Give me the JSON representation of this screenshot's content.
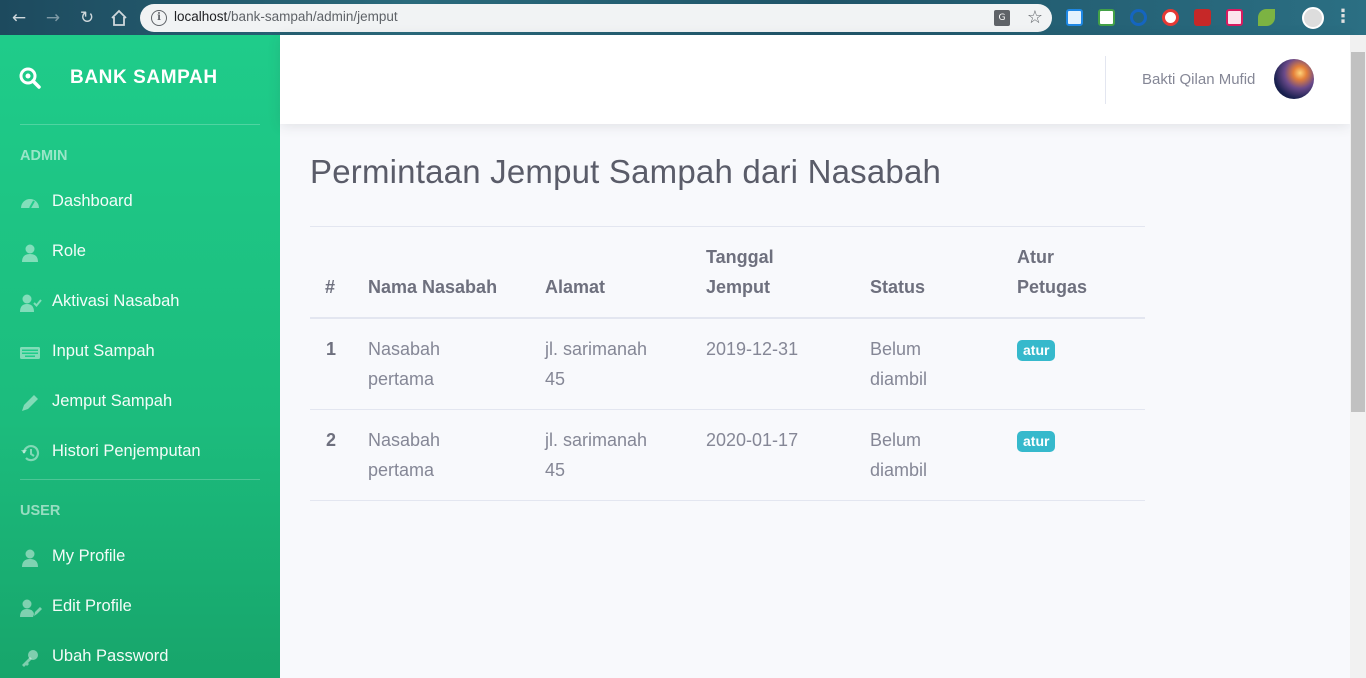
{
  "browser": {
    "url_host": "localhost",
    "url_path": "/bank-sampah/admin/jemput"
  },
  "sidebar": {
    "brand": "BANK SAMPAH",
    "admin_heading": "ADMIN",
    "admin_items": [
      {
        "label": "Dashboard",
        "icon": "tachometer-icon"
      },
      {
        "label": "Role",
        "icon": "user-tie-icon"
      },
      {
        "label": "Aktivasi Nasabah",
        "icon": "user-check-icon"
      },
      {
        "label": "Input Sampah",
        "icon": "keyboard-icon"
      },
      {
        "label": "Jemput Sampah",
        "icon": "pen-icon"
      },
      {
        "label": "Histori Penjemputan",
        "icon": "history-icon"
      }
    ],
    "user_heading": "USER",
    "user_items": [
      {
        "label": "My Profile",
        "icon": "user-icon"
      },
      {
        "label": "Edit Profile",
        "icon": "user-edit-icon"
      },
      {
        "label": "Ubah Password",
        "icon": "key-icon"
      }
    ]
  },
  "topbar": {
    "user_name": "Bakti Qilan Mufid"
  },
  "main": {
    "title": "Permintaan Jemput Sampah dari Nasabah",
    "table": {
      "headers": {
        "num": "#",
        "nama": "Nama Nasabah",
        "alamat": "Alamat",
        "tanggal_1": "Tanggal",
        "tanggal_2": "Jemput",
        "status": "Status",
        "atur_1": "Atur",
        "atur_2": "Petugas"
      },
      "rows": [
        {
          "num": "1",
          "nama_1": "Nasabah",
          "nama_2": "pertama",
          "alamat_1": "jl. sarimanah",
          "alamat_2": "45",
          "tanggal": "2019-12-31",
          "status_1": "Belum",
          "status_2": "diambil",
          "action": "atur"
        },
        {
          "num": "2",
          "nama_1": "Nasabah",
          "nama_2": "pertama",
          "alamat_1": "jl. sarimanah",
          "alamat_2": "45",
          "tanggal": "2020-01-17",
          "status_1": "Belum",
          "status_2": "diambil",
          "action": "atur"
        }
      ]
    }
  },
  "colors": {
    "sidebar_start": "#1fcc8a",
    "sidebar_end": "#17a56b",
    "badge": "#36b9cc",
    "background": "#f8f9fc"
  }
}
